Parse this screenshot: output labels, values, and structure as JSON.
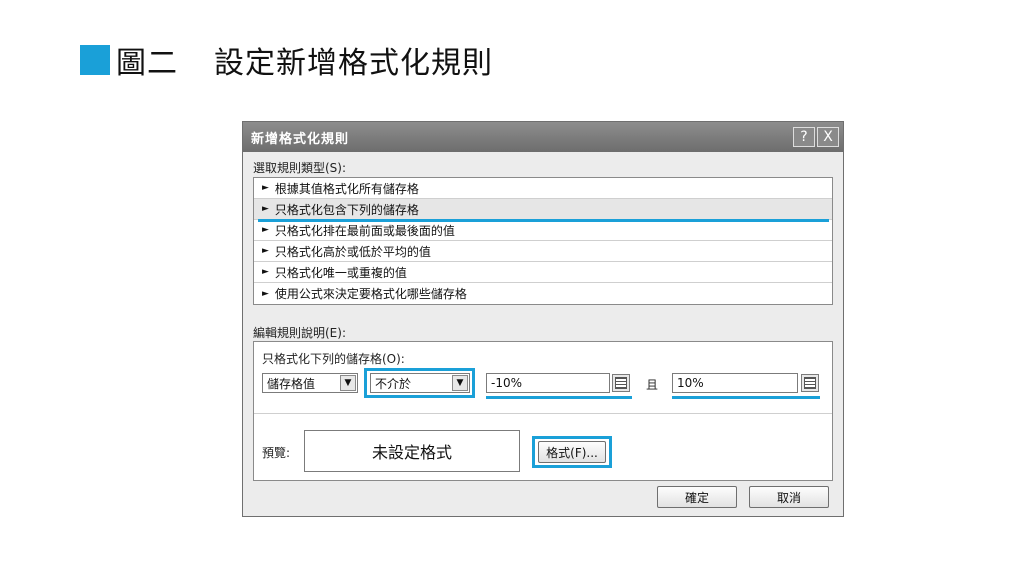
{
  "caption": {
    "label": "圖二",
    "title": "設定新增格式化規則"
  },
  "dialog": {
    "title": "新增格式化規則",
    "help_button": "?",
    "close_button": "X",
    "select_rule_label": "選取規則類型(S):",
    "rule_types": [
      "根據其值格式化所有儲存格",
      "只格式化包含下列的儲存格",
      "只格式化排在最前面或最後面的值",
      "只格式化高於或低於平均的值",
      "只格式化唯一或重複的值",
      "使用公式來決定要格式化哪些儲存格"
    ],
    "selected_rule_index": 1,
    "edit_rule_label": "編輯規則說明(E):",
    "format_only_label": "只格式化下列的儲存格(O):",
    "condition_type": "儲存格值",
    "operator": "不介於",
    "value1": "-10%",
    "and_label": "且",
    "value2": "10%",
    "preview_label": "預覽:",
    "preview_text": "未設定格式",
    "format_button": "格式(F)...",
    "ok_button": "確定",
    "cancel_button": "取消"
  },
  "colors": {
    "highlight": "#1aa0d8",
    "titlebar": "#7a7a7a"
  }
}
